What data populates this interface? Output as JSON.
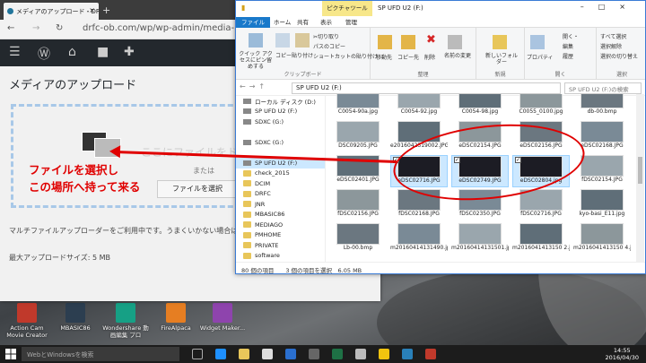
{
  "browser": {
    "tab_title": "メディアのアップロード・DRF",
    "url": "drfc-ob.com/wp/wp-admin/media-new.php",
    "page_title": "メディアのアップロード",
    "dropzone_text": "ここにファイルをドロ",
    "or_text": "または",
    "select_button": "ファイルを選択",
    "info_text": "マルチファイルアップローダーをご利用中です。うまくいかない場合は",
    "max_size": "最大アップロードサイズ: 5 MB"
  },
  "annotation": {
    "line1": "ファイルを選択し",
    "line2": "この場所へ持って来る"
  },
  "explorer": {
    "contextual_tab": "ピクチャツール",
    "title": "SP UFD U2 (F:)",
    "tabs": [
      "ファイル",
      "ホーム",
      "共有",
      "表示",
      "管理"
    ],
    "ribbon": {
      "quick_access": "クイック アクセスにピン留めする",
      "copy": "コピー",
      "paste": "貼り付け",
      "cut": "切り取り",
      "copy_path": "パスのコピー",
      "paste_shortcut": "ショートカットの貼り付け",
      "clipboard": "クリップボード",
      "move_to": "移動先",
      "copy_to": "コピー先",
      "delete": "削除",
      "rename": "名前の変更",
      "organize": "整理",
      "new_folder": "新しいフォルダー",
      "new": "新規",
      "properties": "プロパティ",
      "open": "開く",
      "open_btn": "開く・",
      "edit": "編集",
      "history": "履歴",
      "select_all": "すべて選択",
      "select_none": "選択解除",
      "invert": "選択の切り替え",
      "select": "選択"
    },
    "path": "SP UFD U2 (F:)",
    "search_placeholder": "SP UFD U2 (F:)の検索",
    "nav": [
      {
        "label": "ローカル ディスク (D:)",
        "type": "drive"
      },
      {
        "label": "SP UFD U2 (F:)",
        "type": "drive"
      },
      {
        "label": "SDXC (G:)",
        "type": "drive"
      },
      {
        "label": "",
        "type": "blank"
      },
      {
        "label": "SDXC (G:)",
        "type": "drive"
      },
      {
        "label": "",
        "type": "blank"
      },
      {
        "label": "SP UFD U2 (F:)",
        "type": "drive",
        "selected": true
      },
      {
        "label": "check_2015",
        "type": "folder"
      },
      {
        "label": "DCIM",
        "type": "folder"
      },
      {
        "label": "DRFC",
        "type": "folder"
      },
      {
        "label": "JNR",
        "type": "folder"
      },
      {
        "label": "MBASIC86",
        "type": "folder"
      },
      {
        "label": "MEDIAGO",
        "type": "folder"
      },
      {
        "label": "PMHOME",
        "type": "folder"
      },
      {
        "label": "PRIVATE",
        "type": "folder"
      },
      {
        "label": "software",
        "type": "folder"
      }
    ],
    "files": [
      [
        "C0054-90a.jpg",
        "C0054-92.jpg",
        "C0054-98.jpg",
        "C0055_0100.jpg",
        "db-00.bmp"
      ],
      [
        "DSC09205.JPG",
        "e2016042319002.JPG",
        "eDSC02154.JPG",
        "eDSC02156.JPG",
        "eDSC02168.JPG"
      ],
      [
        "eDSC02401.JPG",
        "eDSC02716.JPG",
        "eDSC02749.JPG",
        "eDSC02804.jpg",
        "fDSC02154.JPG"
      ],
      [
        "fDSC02156.JPG",
        "fDSC02168.JPG",
        "fDSC02350.JPG",
        "fDSC02716.JPG",
        "kyo-basi_E11.jpg"
      ],
      [
        "Lb-00.bmp",
        "m20160414131490.jpa",
        "m20160414131501.jpg",
        "m2016041413150 2.jpg",
        "m2016041413150 4.jpg"
      ]
    ],
    "selected_files": [
      "eDSC02716.JPG",
      "eDSC02749.JPG",
      "eDSC02804.jpg"
    ],
    "status": "80 個の項目　　3 個の項目を選択　6.05 MB"
  },
  "desktop": [
    {
      "label": "Action Cam Movie Creator",
      "color": "#c0392b"
    },
    {
      "label": "MBASIC86",
      "color": "#2c3e50"
    },
    {
      "label": "Wondershare 動画編集 プロ",
      "color": "#16a085"
    },
    {
      "label": "FireAlpaca",
      "color": "#e67e22"
    },
    {
      "label": "Widget Maker...",
      "color": "#8e44ad"
    }
  ],
  "taskbar": {
    "search": "WebとWindowsを検索",
    "time": "14:55",
    "date": "2016/04/30"
  },
  "colors": {
    "accent": "#1979ca",
    "annotation": "#e00000",
    "wp_admin": "#23282d"
  }
}
